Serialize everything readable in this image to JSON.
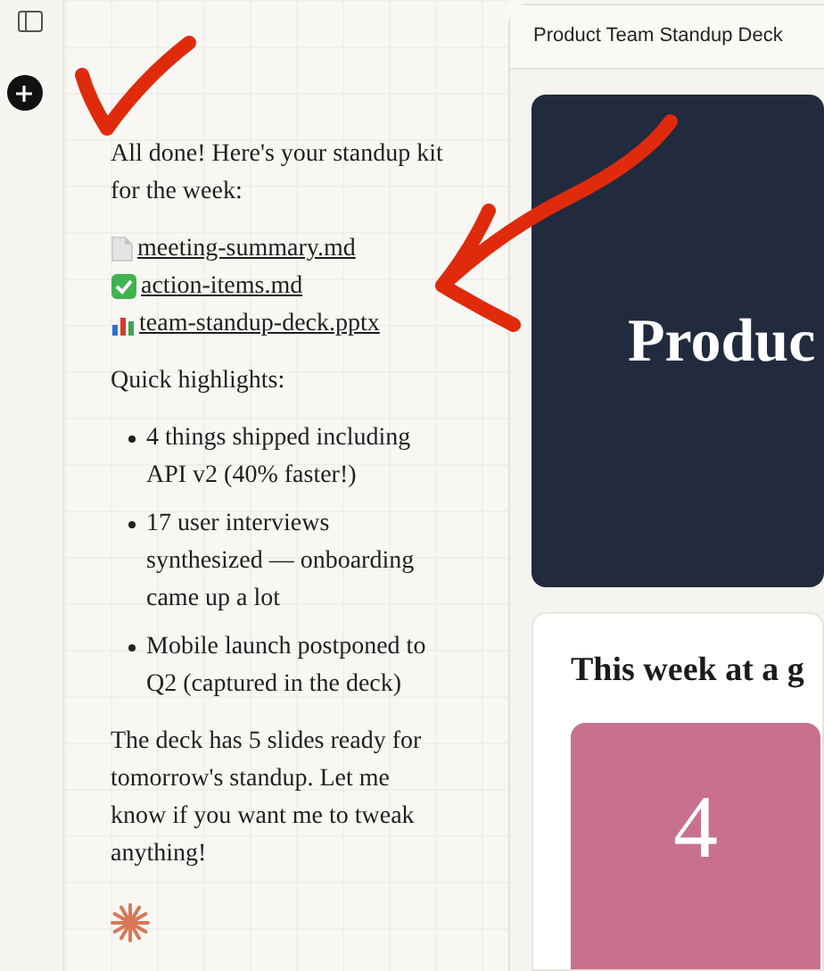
{
  "chat": {
    "intro": "All done! Here's your standup kit for the week:",
    "files": [
      {
        "name": "meeting-summary.md",
        "kind": "document"
      },
      {
        "name": "action-items.md",
        "kind": "checklist"
      },
      {
        "name": "team-standup-deck.pptx",
        "kind": "chart"
      }
    ],
    "highlights_title": "Quick highlights:",
    "highlights": [
      "4 things shipped including API v2 (40% faster!)",
      "17 user interviews synthesized — onboarding came up a lot",
      "Mobile launch postponed to Q2 (captured in the deck)"
    ],
    "closing": "The deck has 5 slides ready for tomorrow's standup. Let me know if you want me to tweak anything!"
  },
  "preview": {
    "title": "Product Team Standup Deck",
    "slides": [
      {
        "kind": "title",
        "heading": "Produc"
      },
      {
        "kind": "stats",
        "heading": "This week at a g",
        "stats": [
          {
            "value": "4",
            "color": "#c97090"
          }
        ]
      }
    ]
  }
}
